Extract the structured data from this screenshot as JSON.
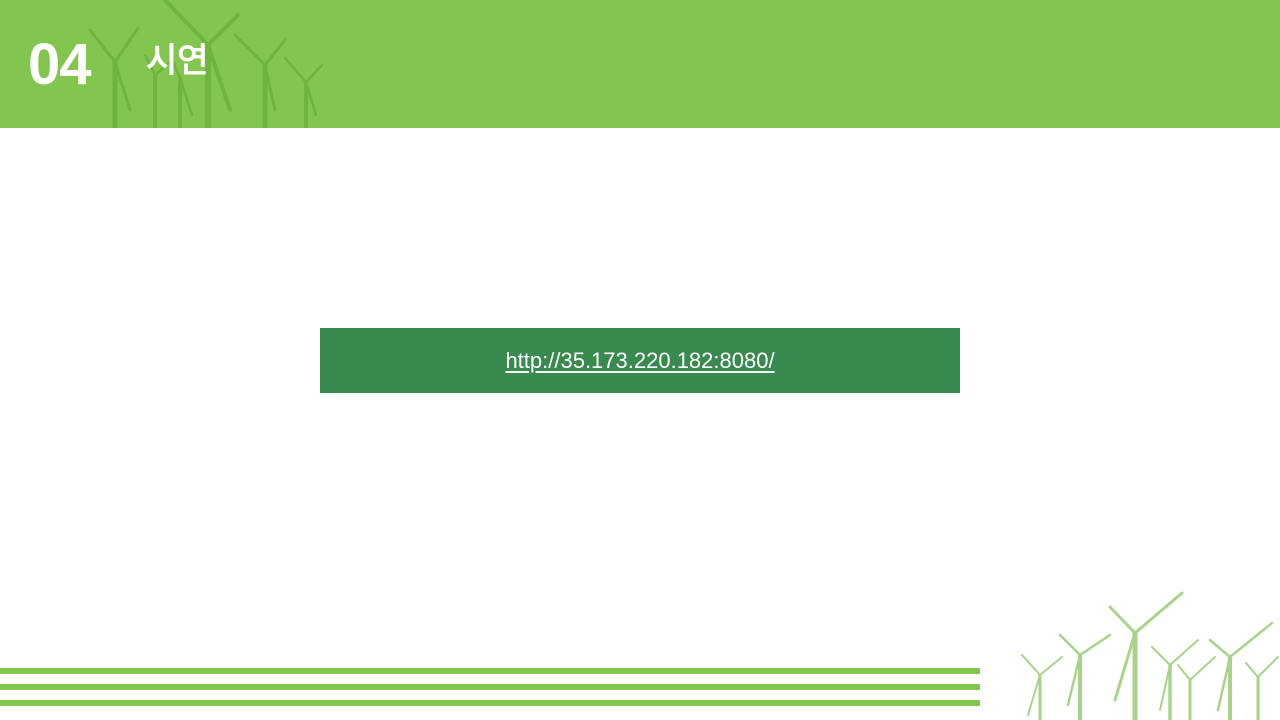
{
  "header": {
    "section_number": "04",
    "section_title": "시연"
  },
  "link": {
    "url": "http://35.173.220.182:8080/"
  },
  "colors": {
    "header_green": "#82c650",
    "link_box_green": "#388a4e",
    "text_white": "#ffffff"
  },
  "decorations": {
    "header_icon": "wind-turbines",
    "footer_icon": "wind-turbines"
  }
}
